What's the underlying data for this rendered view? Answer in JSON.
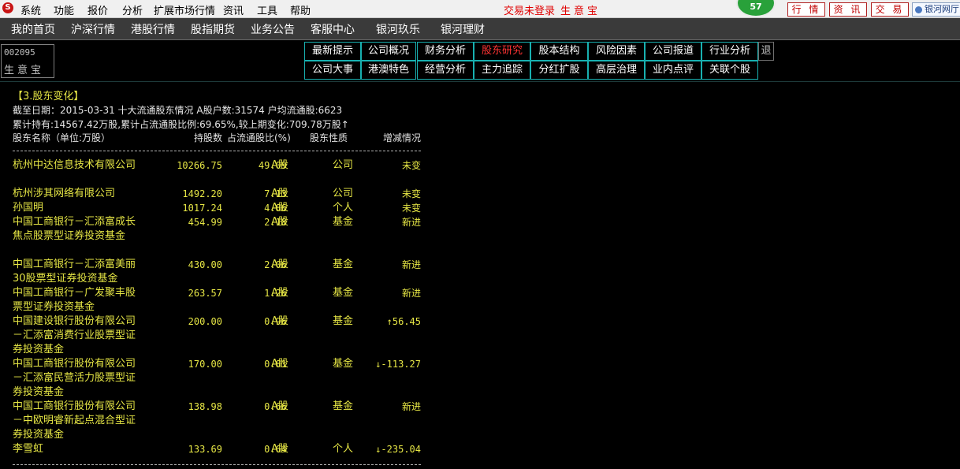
{
  "menubar": {
    "logo_glyph": "S",
    "items": [
      "系统",
      "功能",
      "报价",
      "分析",
      "扩展市场行情",
      "资讯",
      "工具",
      "帮助"
    ],
    "login_status": "交易未登录",
    "product_name": "生意宝",
    "badge_value": "57",
    "top_buttons": [
      "行 情",
      "资 讯",
      "交 易"
    ],
    "brand_button": "银河网厅"
  },
  "navbar": {
    "items": [
      "我的首页",
      "沪深行情",
      "港股行情",
      "股指期货",
      "业务公告",
      "客服中心",
      "银河玖乐",
      "银河理财"
    ]
  },
  "stock": {
    "code": "002095",
    "name": "生意宝"
  },
  "tabs": {
    "row1": [
      "最新提示",
      "公司概况",
      "财务分析",
      "股东研究",
      "股本结构",
      "风险因素",
      "公司报道",
      "行业分析"
    ],
    "row2": [
      "公司大事",
      "港澳特色",
      "经营分析",
      "主力追踪",
      "分红扩股",
      "高层治理",
      "业内点评",
      "关联个股"
    ],
    "active": "股东研究",
    "exit": "退"
  },
  "section": {
    "title": "【3.股东变化】",
    "line1": "截至日期：2015-03-31 十大流通股东情况 A股户数:31574 户均流通股:6623",
    "line2": "累计持有:14567.42万股,累计占流通股比例:69.65%,较上期变化:709.78万股↑",
    "headers": {
      "name": "股东名称（单位:万股）",
      "holding": "持股数",
      "ratio": "占流通股比(%)",
      "nature": "股东性质",
      "change": "增减情况"
    },
    "rows": [
      {
        "name": "杭州中达信息技术有限公司",
        "holding": "10266.75",
        "ratio": "49.09",
        "type": "A股",
        "nature": "公司",
        "change": "未变"
      },
      {
        "name": "杭州涉其网络有限公司",
        "holding": "1492.20",
        "ratio": "7.13",
        "type": "A股",
        "nature": "公司",
        "change": "未变"
      },
      {
        "name": "孙国明",
        "holding": "1017.24",
        "ratio": "4.86",
        "type": "A股",
        "nature": "个人",
        "change": "未变"
      },
      {
        "name": "中国工商银行－汇添富成长焦点股票型证券投资基金",
        "holding": "454.99",
        "ratio": "2.18",
        "type": "A股",
        "nature": "基金",
        "change": "新进"
      },
      {
        "name": "中国工商银行－汇添富美丽30股票型证券投资基金",
        "holding": "430.00",
        "ratio": "2.06",
        "type": "A股",
        "nature": "基金",
        "change": "新进"
      },
      {
        "name": "中国工商银行－广发聚丰股票型证券投资基金",
        "holding": "263.57",
        "ratio": "1.26",
        "type": "A股",
        "nature": "基金",
        "change": "新进"
      },
      {
        "name": "中国建设银行股份有限公司－汇添富消费行业股票型证券投资基金",
        "holding": "200.00",
        "ratio": "0.96",
        "type": "A股",
        "nature": "基金",
        "change": "↑56.45"
      },
      {
        "name": "中国工商银行股份有限公司－汇添富民营活力股票型证券投资基金",
        "holding": "170.00",
        "ratio": "0.81",
        "type": "A股",
        "nature": "基金",
        "change": "↓-113.27"
      },
      {
        "name": "中国工商银行股份有限公司－中欧明睿新起点混合型证券投资基金",
        "holding": "138.98",
        "ratio": "0.66",
        "type": "A股",
        "nature": "基金",
        "change": "新进"
      },
      {
        "name": "李雪虹",
        "holding": "133.69",
        "ratio": "0.64",
        "type": "A股",
        "nature": "个人",
        "change": "↓-235.04"
      }
    ]
  }
}
